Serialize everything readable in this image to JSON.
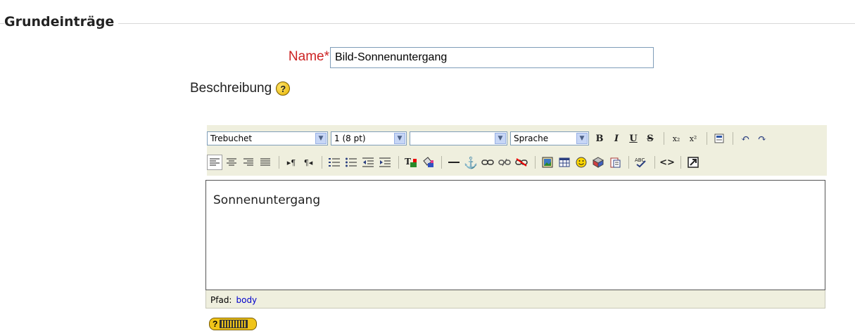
{
  "section": {
    "title": "Grundeinträge"
  },
  "form": {
    "name_label": "Name",
    "required_mark": "*",
    "name_value": "Bild-Sonnenuntergang",
    "description_label": "Beschreibung"
  },
  "toolbar": {
    "font_family": "Trebuchet",
    "font_size": "1 (8 pt)",
    "format": "",
    "language": "Sprache",
    "bold": "B",
    "italic": "I",
    "underline": "U",
    "strike": "S",
    "subscript": "x₂",
    "superscript": "x²",
    "html_source": "<>"
  },
  "editor": {
    "content": "Sonnenuntergang"
  },
  "statusbar": {
    "path_label": "Pfad:",
    "path_value": "body"
  },
  "help": {
    "symbol": "?"
  }
}
